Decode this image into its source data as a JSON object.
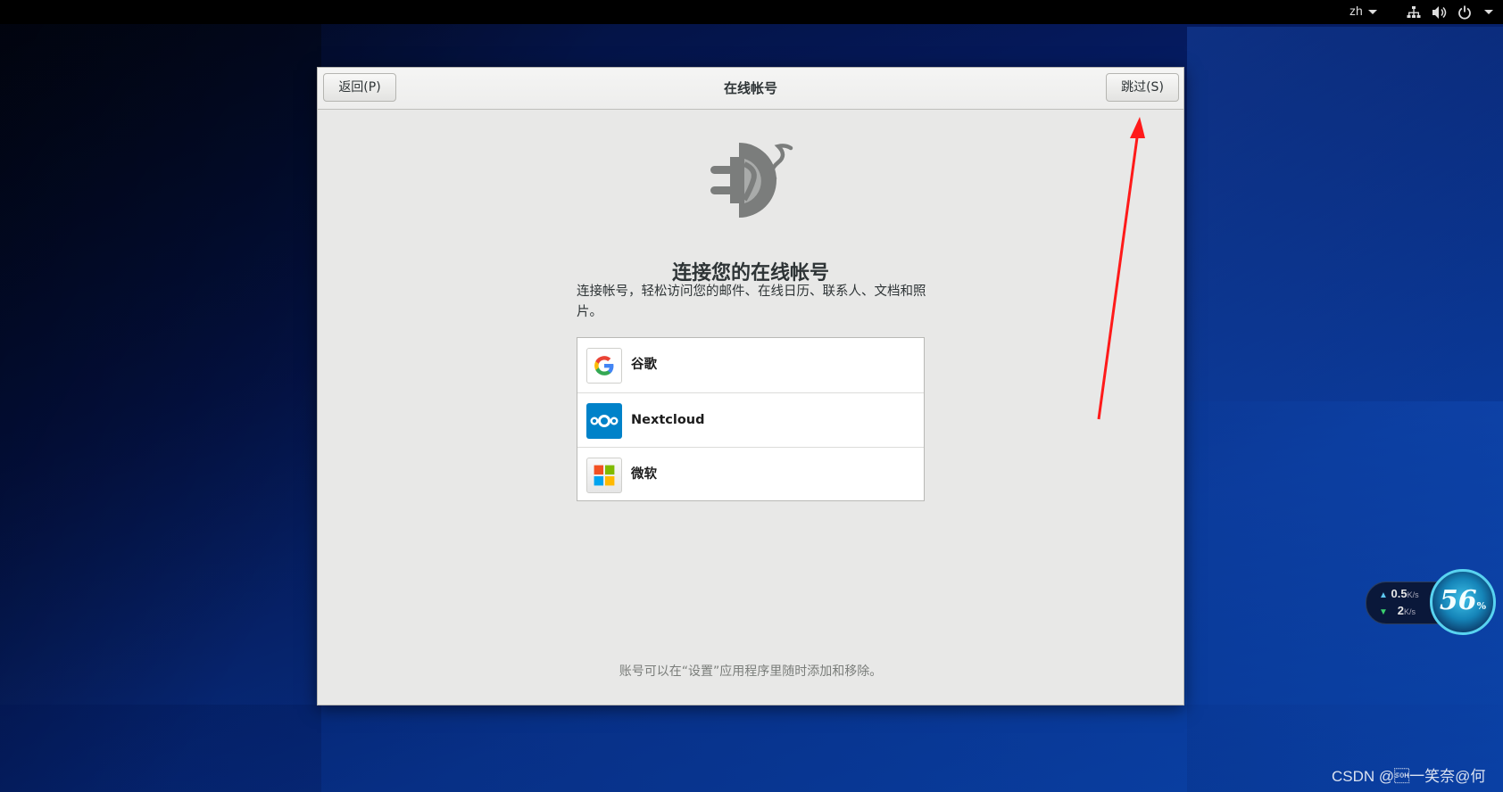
{
  "topbar": {
    "language": "zh"
  },
  "dialog": {
    "back_label": "返回(P)",
    "title": "在线帐号",
    "skip_label": "跳过(S)"
  },
  "content": {
    "heading": "连接您的在线帐号",
    "description": "连接帐号，轻松访问您的邮件、在线日历、联系人、文档和照片。",
    "providers": [
      {
        "name": "谷歌",
        "icon": "google-icon"
      },
      {
        "name": "Nextcloud",
        "icon": "nextcloud-icon"
      },
      {
        "name": "微软",
        "icon": "microsoft-icon"
      }
    ],
    "footer_note": "账号可以在“设置”应用程序里随时添加和移除。"
  },
  "speed_widget": {
    "upload_value": "0.5",
    "upload_unit": "K/s",
    "download_value": "2",
    "download_unit": "K/s",
    "percent_value": "56",
    "percent_unit": "%"
  },
  "watermark": "CSDN @\u0001一笑奈@何",
  "colors": {
    "annotation_arrow": "#ff1a1a",
    "desktop_blue": "#0a3a9a",
    "nextcloud_blue": "#0082c9"
  }
}
